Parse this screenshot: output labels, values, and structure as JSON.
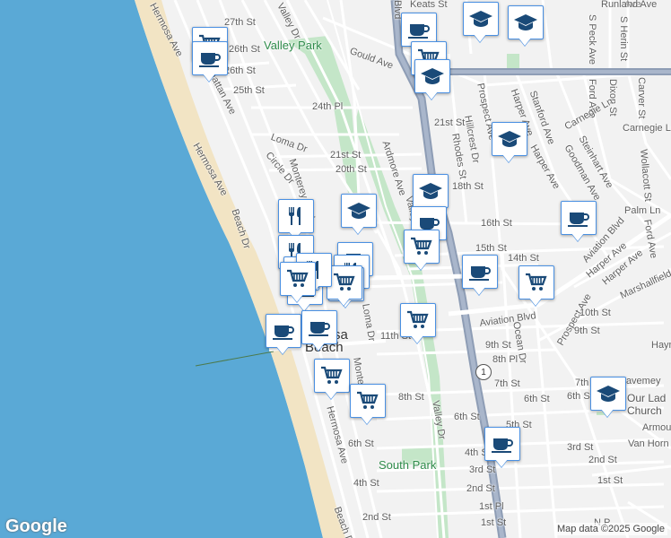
{
  "streets": {
    "hermosa_ave_nw": "Hermosa Ave",
    "hermosa_ave_mid": "Hermosa Ave",
    "hermosa_ave_s": "Hermosa Ave",
    "manhattan_ave": "Manhattan Ave",
    "beach_dr_n": "Beach Dr",
    "beach_dr_s": "Beach Dr",
    "s27th": "27th St",
    "s26th_a": "26th St",
    "s26th_b": "26th St",
    "s25th": "25th St",
    "s24th_pl": "24th Pl",
    "loma_dr_n": "Loma Dr",
    "loma_dr_s": "Loma Dr",
    "circle_dr": "Circle Dr",
    "monterey_blvd_n": "Monterey Blvd",
    "monterey_blvd_s": "Monterey Blvd",
    "s21st_w": "21st St",
    "s20th_w": "20th St",
    "ardmore_ave": "Ardmore Ave",
    "valley_dr_n": "Valley Dr",
    "valley_dr_s": "Valley Dr",
    "valley_dr_top": "Valley Dr",
    "gould_ave": "Gould Ave",
    "keats_st": "Keats St",
    "blvd_top": "Blvd",
    "s21st_e": "21st St",
    "hillcrest_dr": "Hillcrest Dr",
    "rhodes_st": "Rhodes St",
    "s18th": "18th St",
    "s16th": "16th St",
    "s15th": "15th St",
    "s14th": "14th St",
    "prospect_ave_n": "Prospect Ave",
    "prospect_ave_s": "Prospect Ave",
    "harper_ave_1": "Harper Ave",
    "harper_ave_2": "Harper Ave",
    "harper_ave_3": "Harper Ave",
    "harper_ave_4": "Harper Ave",
    "stanford_ave": "Stanford Ave",
    "goodman_ave": "Goodman Ave",
    "steinhart_ave": "Steinhart Ave",
    "ford_ave_n": "Ford Ave",
    "ford_ave_s": "Ford Ave",
    "dixon_st": "Dixon St",
    "carver_st": "Carver St",
    "s_peck_ave": "S Peck Ave",
    "s_herin_st": "S Herin St",
    "carnegie_ln_1": "Carnegie Ln",
    "carnegie_ln_2": "Carnegie Ln",
    "wollacott_st": "Wollacott St",
    "palm_ln": "Palm Ln",
    "runland_ave": "Runland Ave",
    "aviation_blvd_ne": "Aviation Blvd",
    "aviation_blvd": "Aviation Blvd",
    "marshallfield": "Marshallfield",
    "s10th": "10th St",
    "s11th": "11th St",
    "s9th_e": "9th St",
    "s9th_w": "9th St",
    "s8th_pl": "8th Pl",
    "s8th": "8th St",
    "s7th": "7th St",
    "s7th_pl": "7th Pl",
    "s6th_w": "6th St",
    "s6th_mid": "6th St",
    "s6th_e1": "6th St",
    "s6th_e2": "6th St",
    "s5th": "5th St",
    "s4th_w": "4th St",
    "s4th_e": "4th St",
    "s3rd_w": "3rd St",
    "s3rd_e": "3rd St",
    "s2nd_w": "2nd St",
    "s2nd_mid": "2nd St",
    "s2nd_e": "2nd St",
    "s1st_e": "1st St",
    "s1st_pl": "1st Pl",
    "s1st_w": "1st St",
    "ocean_dr": "Ocean Dr",
    "havemeyer": "Havemey",
    "armour": "Armou",
    "van_horne": "Van Horn",
    "hayn": "Hayn",
    "n_p": "N P",
    "ave_top": "Ave"
  },
  "places": {
    "valley_park": "Valley Park",
    "south_park": "South Park",
    "city_a": "sa",
    "city_b": "Beach",
    "church_1": "Our Lad",
    "church_2": "Church"
  },
  "highway_shield": "1",
  "attribution": "Map data ©2025 Google",
  "logo": "Google",
  "markers": [
    {
      "icon": "cart"
    },
    {
      "icon": "coffee"
    },
    {
      "icon": "coffee"
    },
    {
      "icon": "school"
    },
    {
      "icon": "school"
    },
    {
      "icon": "cart"
    },
    {
      "icon": "school"
    },
    {
      "icon": "school"
    },
    {
      "icon": "school"
    },
    {
      "icon": "restaurant"
    },
    {
      "icon": "school"
    },
    {
      "icon": "coffee"
    },
    {
      "icon": "cart"
    },
    {
      "icon": "coffee"
    },
    {
      "icon": "restaurant"
    },
    {
      "icon": "coffee"
    },
    {
      "icon": "cart"
    },
    {
      "icon": "coffee"
    },
    {
      "icon": "restaurant"
    },
    {
      "icon": "cart"
    },
    {
      "icon": "cart"
    },
    {
      "icon": "coffee"
    },
    {
      "icon": "coffee"
    },
    {
      "icon": "cart"
    },
    {
      "icon": "coffee"
    },
    {
      "icon": "cart"
    },
    {
      "icon": "cart"
    },
    {
      "icon": "school"
    },
    {
      "icon": "coffee"
    },
    {
      "icon": "coffee"
    },
    {
      "icon": "restaurant"
    },
    {
      "icon": "cart"
    }
  ],
  "colors": {
    "ocean": "#5aa9d6",
    "beach": "#f2e4c4",
    "land": "#f2f2f2",
    "park": "#c4e6c8",
    "highway": "#8e9db5",
    "marker_icon": "#1a4a78",
    "marker_border": "#4a90e2"
  }
}
